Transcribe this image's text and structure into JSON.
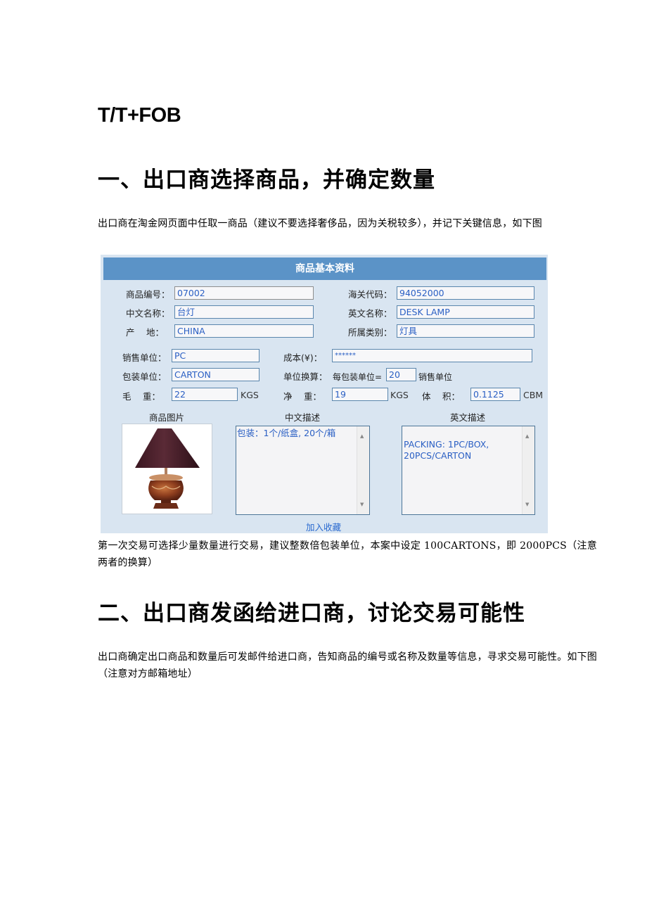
{
  "doc_title": "T/T+FOB",
  "section1": {
    "heading": "一、出口商选择商品，并确定数量",
    "intro": "出口商在淘金网页面中任取一商品（建议不要选择奢侈品，因为关税较多），并记下关键信息，如下图",
    "after": "第一次交易可选择少量数量进行交易，建议整数倍包装单位，本案中设定 100CARTONS，即 2000PCS（注意两者的换算）"
  },
  "section2": {
    "heading": "二、出口商发函给进口商，讨论交易可能性",
    "intro": "出口商确定出口商品和数量后可发邮件给进口商，告知商品的编号或名称及数量等信息，寻求交易可能性。如下图（注意对方邮箱地址）"
  },
  "form": {
    "header": "商品基本资料",
    "labels": {
      "product_no": "商品编号：",
      "customs_code": "海关代码：",
      "cn_name": "中文名称：",
      "en_name": "英文名称：",
      "origin": "产　 地：",
      "category": "所属类别：",
      "sales_unit": "销售单位：",
      "cost": "成本(¥)：",
      "pack_unit": "包装单位：",
      "conversion": "单位换算：",
      "gross_weight": "毛　 重：",
      "net_weight": "净　 重：",
      "volume": "体　 积：",
      "image": "商品图片",
      "cn_desc": "中文描述",
      "en_desc": "英文描述",
      "per_pack": "每包装单位=",
      "per_pack_suffix": "销售单位"
    },
    "values": {
      "product_no": "07002",
      "customs_code": "94052000",
      "cn_name": "台灯",
      "en_name": "DESK LAMP",
      "origin": "CHINA",
      "category": "灯具",
      "sales_unit": "PC",
      "cost": "******",
      "pack_unit": "CARTON",
      "per_pack_qty": "20",
      "gross_weight": "22",
      "net_weight": "19",
      "volume": "0.1125",
      "cn_desc": "包装：1个/纸盒, 20个/箱",
      "en_desc": "PACKING: 1PC/BOX,\n20PCS/CARTON"
    },
    "units": {
      "kgs": "KGS",
      "cbm": "CBM"
    },
    "add_favorite": "加入收藏",
    "colors": {
      "header_bg": "#5b93c7",
      "panel_bg": "#d9e5f1",
      "value_text": "#2a5fc4"
    }
  }
}
